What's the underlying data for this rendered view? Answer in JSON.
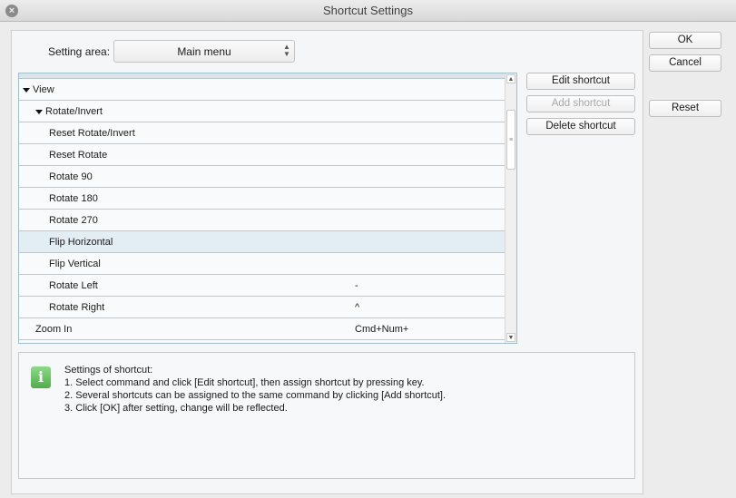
{
  "window": {
    "title": "Shortcut Settings",
    "close_icon": "close-icon"
  },
  "setting_area": {
    "label": "Setting area:",
    "value": "Main menu"
  },
  "list": {
    "rows": [
      {
        "command": "View",
        "shortcut": "",
        "level": 0,
        "expanded": true
      },
      {
        "command": "Rotate/Invert",
        "shortcut": "",
        "level": 1,
        "expanded": true
      },
      {
        "command": "Reset Rotate/Invert",
        "shortcut": "",
        "level": 2
      },
      {
        "command": "Reset Rotate",
        "shortcut": "",
        "level": 2
      },
      {
        "command": "Rotate 90",
        "shortcut": "",
        "level": 2
      },
      {
        "command": "Rotate 180",
        "shortcut": "",
        "level": 2
      },
      {
        "command": "Rotate 270",
        "shortcut": "",
        "level": 2
      },
      {
        "command": "Flip Horizontal",
        "shortcut": "",
        "level": 2,
        "selected": true
      },
      {
        "command": "Flip Vertical",
        "shortcut": "",
        "level": 2
      },
      {
        "command": "Rotate Left",
        "shortcut": "-",
        "level": 2
      },
      {
        "command": "Rotate Right",
        "shortcut": "^",
        "level": 2
      },
      {
        "command": "Zoom In",
        "shortcut": "Cmd+Num+",
        "level": 1
      }
    ]
  },
  "buttons": {
    "edit": "Edit shortcut",
    "add": "Add shortcut",
    "delete": "Delete shortcut",
    "ok": "OK",
    "cancel": "Cancel",
    "reset": "Reset"
  },
  "info": {
    "icon": "info-icon",
    "lines": [
      "Settings of shortcut:",
      "1. Select command and click [Edit shortcut], then assign shortcut by pressing key.",
      "2. Several shortcuts can be assigned to the same command by clicking [Add shortcut].",
      "3. Click [OK] after setting, change will be reflected."
    ]
  }
}
